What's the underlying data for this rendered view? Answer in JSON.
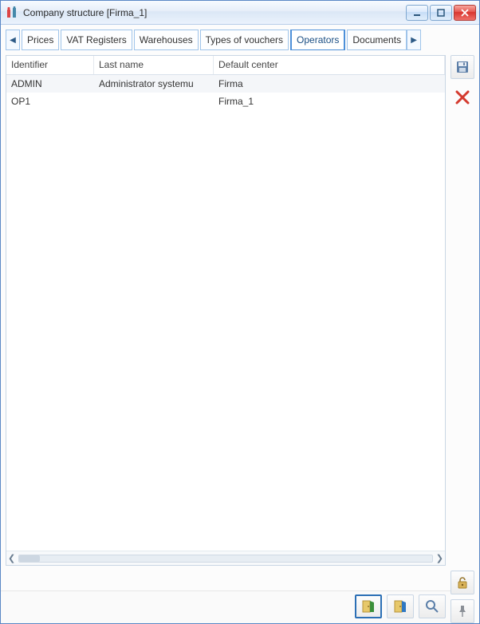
{
  "window": {
    "title": "Company structure [Firma_1]"
  },
  "tabs": [
    {
      "label": "Prices",
      "active": false
    },
    {
      "label": "VAT Registers",
      "active": false
    },
    {
      "label": "Warehouses",
      "active": false
    },
    {
      "label": "Types of vouchers",
      "active": false
    },
    {
      "label": "Operators",
      "active": true
    },
    {
      "label": "Documents",
      "active": false
    }
  ],
  "grid": {
    "columns": [
      {
        "key": "identifier",
        "label": "Identifier"
      },
      {
        "key": "last_name",
        "label": "Last name"
      },
      {
        "key": "default_center",
        "label": "Default center"
      }
    ],
    "rows": [
      {
        "identifier": "ADMIN",
        "last_name": "Administrator systemu",
        "default_center": "Firma"
      },
      {
        "identifier": "OP1",
        "last_name": "",
        "default_center": "Firma_1"
      }
    ]
  },
  "tools": {
    "save": "save-icon",
    "delete": "delete-icon",
    "unlock": "unlock-icon",
    "pin": "pin-icon",
    "open_primary": "door-open-icon",
    "open_secondary": "door-open-icon",
    "search": "magnifier-icon"
  }
}
